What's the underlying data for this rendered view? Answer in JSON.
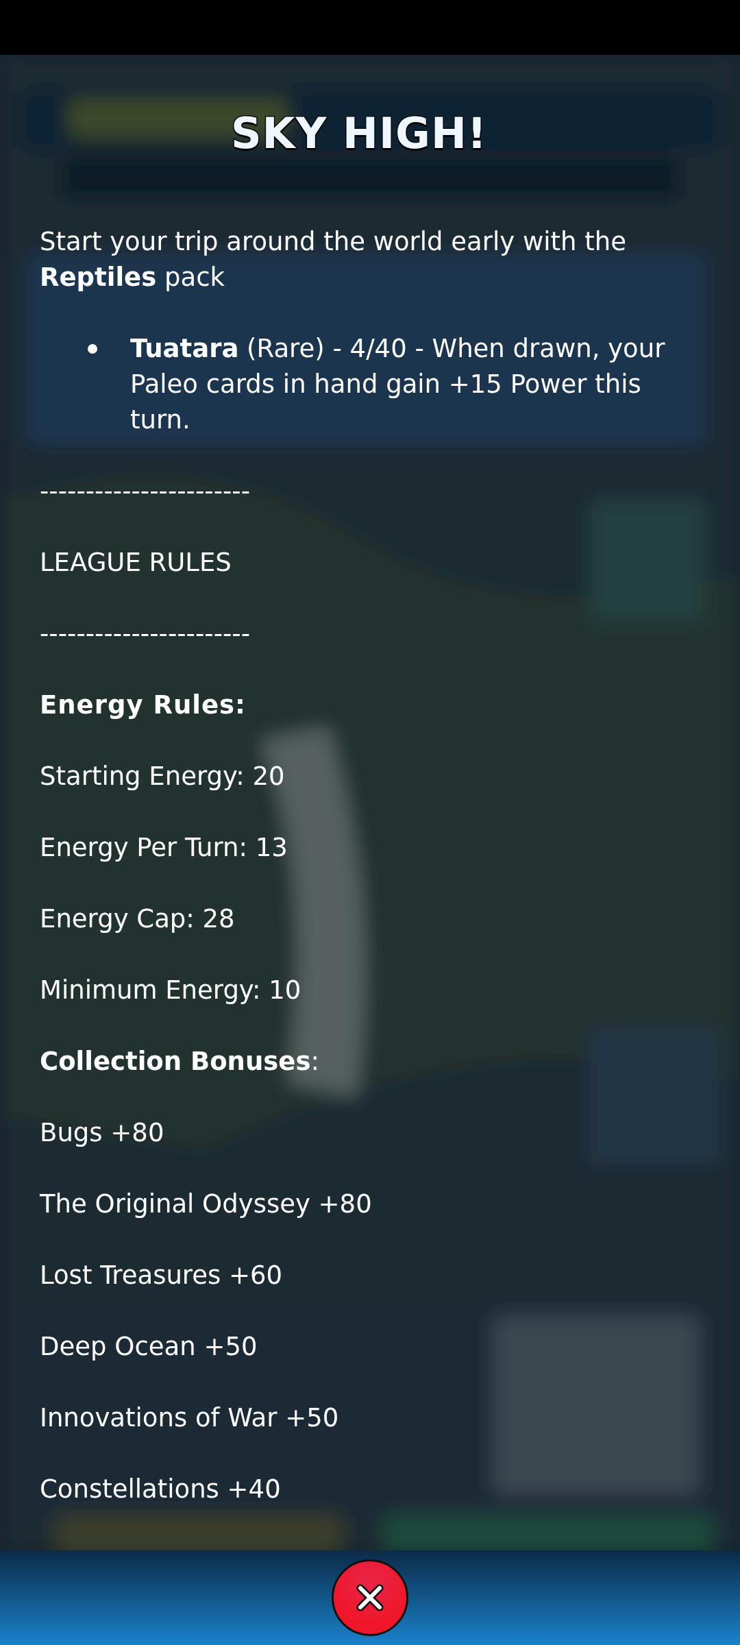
{
  "title": "SKY HIGH!",
  "intro": "Start your trip around the world early with the **Reptiles** pack",
  "bullets": [
    "**Tuatara** (Rare) - 4/40 - When drawn, your Paleo cards in hand gain +15 Power this turn."
  ],
  "lines": [
    {
      "kind": "text",
      "text": "-----------------------"
    },
    {
      "kind": "text",
      "text": "LEAGUE RULES"
    },
    {
      "kind": "text",
      "text": "-----------------------"
    },
    {
      "kind": "heading",
      "text": "Energy Rules:"
    },
    {
      "kind": "text",
      "text": "Starting Energy: 20"
    },
    {
      "kind": "text",
      "text": "Energy Per Turn: 13"
    },
    {
      "kind": "text",
      "text": "Energy Cap: 28"
    },
    {
      "kind": "text",
      "text": "Minimum Energy: 10"
    },
    {
      "kind": "text",
      "text": "**Collection Bonuses**:"
    },
    {
      "kind": "text",
      "text": "Bugs +80"
    },
    {
      "kind": "text",
      "text": "The Original Odyssey +80"
    },
    {
      "kind": "text",
      "text": "Lost Treasures +60"
    },
    {
      "kind": "text",
      "text": "Deep Ocean +50"
    },
    {
      "kind": "text",
      "text": "Innovations of War +50"
    },
    {
      "kind": "text",
      "text": "Constellations +40"
    }
  ]
}
